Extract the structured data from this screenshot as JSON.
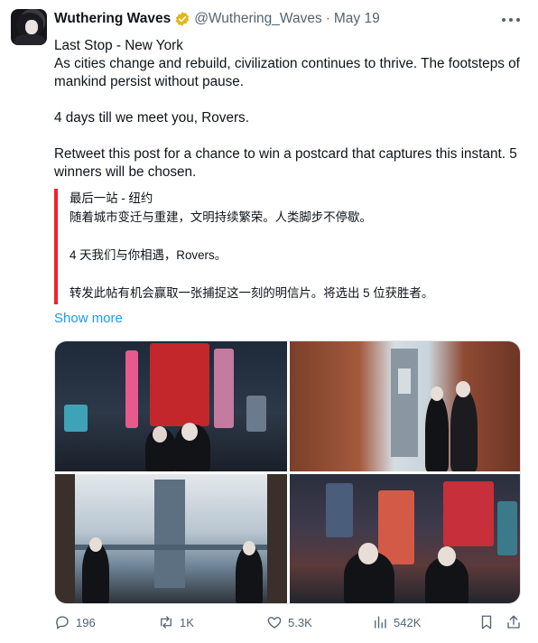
{
  "tweet": {
    "display_name": "Wuthering Waves",
    "handle": "@Wuthering_Waves",
    "separator": "·",
    "date": "May 19",
    "text": {
      "line1": "Last Stop - New York",
      "line2": "As cities change and rebuild, civilization continues to thrive. The footsteps of mankind persist without pause.",
      "line3": "4 days till we meet you, Rovers.",
      "line4": "Retweet this post for a chance to win a postcard that captures this instant. 5 winners will be chosen."
    },
    "translation": {
      "line1": "最后一站 - 纽约",
      "line2": "随着城市变迁与重建，文明持续繁荣。人类脚步不停歇。",
      "line3": "4 天我们与你相遇，Rovers。",
      "line4": "转发此帖有机会赢取一张捕捉这一刻的明信片。将选出 5 位获胜者。"
    },
    "show_more": "Show more"
  },
  "actions": {
    "replies": "196",
    "retweets": "1K",
    "likes": "5.3K",
    "views": "542K"
  },
  "icons": [
    "verified-badge-icon",
    "more-icon",
    "reply-icon",
    "retweet-icon",
    "like-icon",
    "views-icon",
    "bookmark-icon",
    "share-icon"
  ],
  "colors": {
    "text": "#0f1419",
    "secondary": "#536471",
    "link": "#1d9bf0",
    "quote_bar": "#f4212e",
    "verified_gold": "#e2b719"
  }
}
